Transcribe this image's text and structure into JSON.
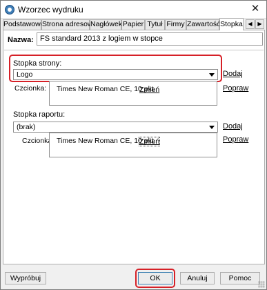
{
  "window": {
    "title": "Wzorzec wydruku",
    "close_glyph": "✕"
  },
  "tabs": [
    {
      "label": "Podstawowe"
    },
    {
      "label": "Strona adresowa"
    },
    {
      "label": "Nagłówek"
    },
    {
      "label": "Papier"
    },
    {
      "label": "Tytuł"
    },
    {
      "label": "Firmy"
    },
    {
      "label": "Zawartość"
    },
    {
      "label": "Stopka",
      "active": true
    }
  ],
  "tab_scroll": {
    "left_glyph": "◀",
    "right_glyph": "▶"
  },
  "name": {
    "label": "Nazwa:",
    "value": "FS standard 2013 z logiem w stopce"
  },
  "page_footer": {
    "label": "Stopka strony:",
    "selected": "Logo",
    "add_label": "Dodaj",
    "edit_label": "Popraw",
    "font_label": "Czcionka:",
    "font_value": "Times New Roman CE, 10 pkt.",
    "change_label": "Zmień"
  },
  "report_footer": {
    "label": "Stopka raportu:",
    "selected": "(brak)",
    "add_label": "Dodaj",
    "edit_label": "Popraw",
    "font_label": "Czcionka:",
    "font_value": "Times New Roman CE, 10 pkt.",
    "change_label": "Zmień"
  },
  "buttons": {
    "try_label": "Wypróbuj",
    "ok_label": "OK",
    "cancel_label": "Anuluj",
    "help_label": "Pomoc"
  },
  "colors": {
    "highlight": "#d62027",
    "default_button_border": "#3c7fb1"
  }
}
